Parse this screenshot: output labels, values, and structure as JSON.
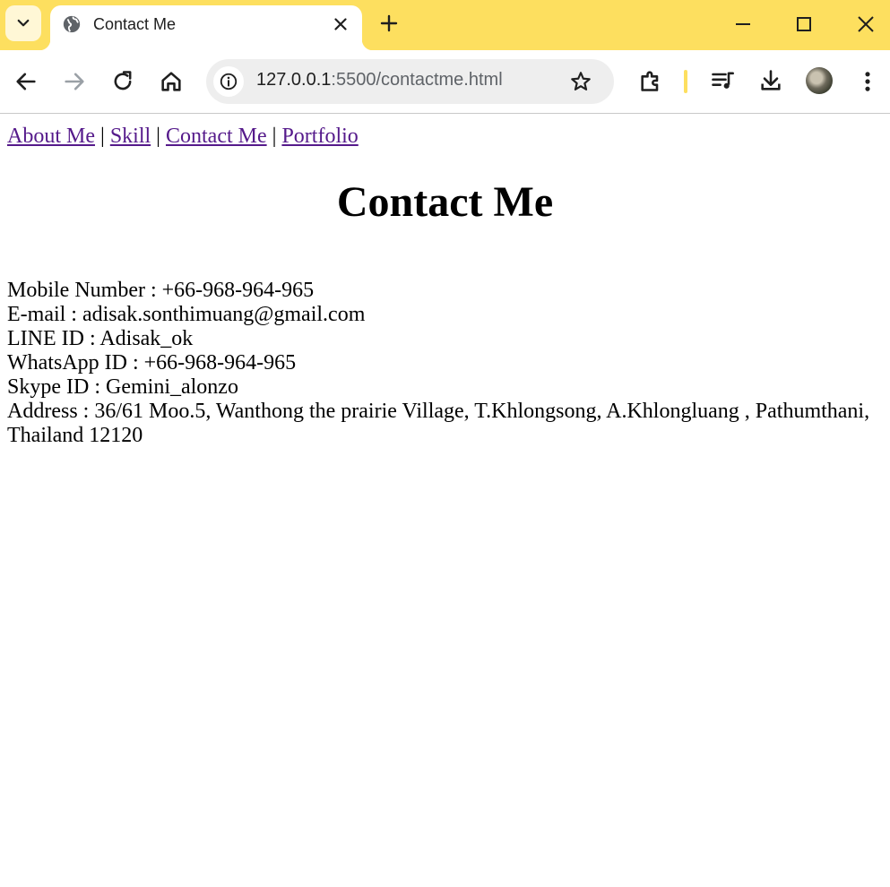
{
  "browser": {
    "tab": {
      "title": "Contact Me",
      "favicon": "globe-icon"
    },
    "address": {
      "host": "127.0.0.1",
      "path": ":5500/contactme.html"
    },
    "colors": {
      "frame": "#fddf5f",
      "tab": "#ffffff"
    },
    "icons": [
      "tab-search-icon",
      "close-icon",
      "plus-icon",
      "minimize-icon",
      "maximize-icon",
      "window-close-icon",
      "back-arrow-icon",
      "forward-arrow-icon",
      "reload-icon",
      "home-icon",
      "site-info-icon",
      "star-icon",
      "extensions-icon",
      "media-queue-icon",
      "download-icon",
      "profile-avatar",
      "more-menu-icon"
    ]
  },
  "nav": {
    "links": [
      "About Me",
      "Skill",
      "Contact Me",
      "Portfolio"
    ],
    "separator": " | "
  },
  "page": {
    "title": "Contact Me",
    "lines": [
      "Mobile Number : +66-968-964-965",
      "E-mail : adisak.sonthimuang@gmail.com",
      "LINE ID : Adisak_ok",
      "WhatsApp ID : +66-968-964-965",
      "Skype ID : Gemini_alonzo",
      "Address : 36/61 Moo.5, Wanthong the prairie Village, T.Khlongsong, A.Khlongluang , Pathumthani, Thailand 12120"
    ]
  },
  "colors": {
    "link": "#551a8b",
    "text": "#000000"
  }
}
